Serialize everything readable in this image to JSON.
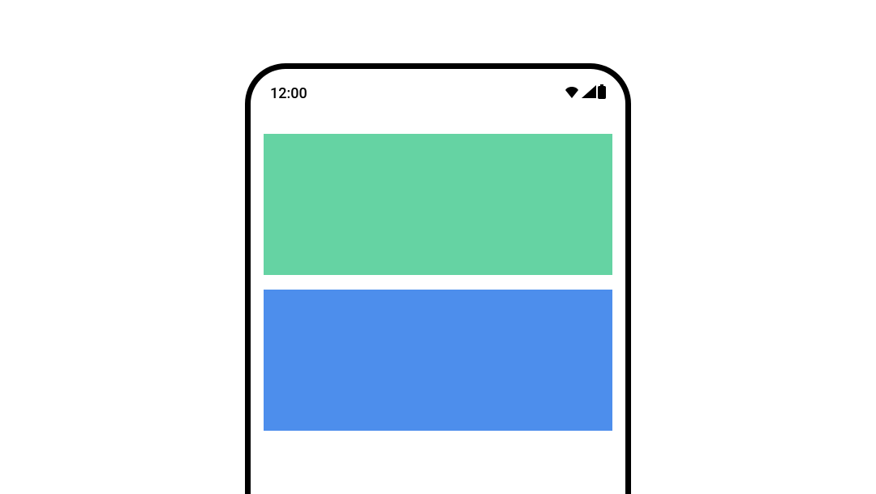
{
  "status_bar": {
    "time": "12:00"
  },
  "blocks": [
    {
      "name": "green-block",
      "color": "#65d3a3"
    },
    {
      "name": "blue-block",
      "color": "#4d8eec"
    }
  ]
}
